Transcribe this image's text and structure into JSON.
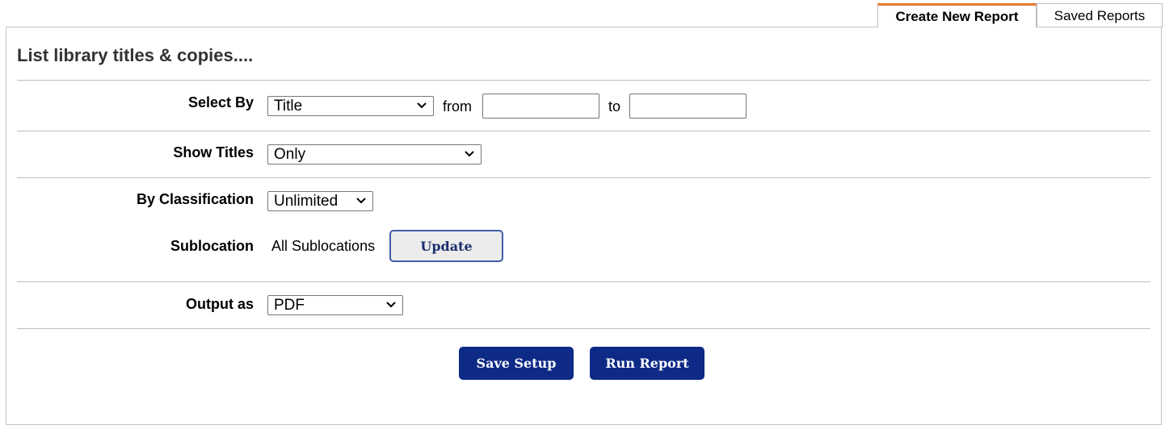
{
  "tabs": {
    "create_new_report": "Create New Report",
    "saved_reports": "Saved Reports",
    "active_accent": "#e8772e"
  },
  "report": {
    "title": "List library titles & copies...."
  },
  "select_by": {
    "label": "Select By",
    "value": "Title",
    "from_label": "from",
    "from_value": "",
    "to_label": "to",
    "to_value": ""
  },
  "show_titles": {
    "label": "Show Titles",
    "value": "Only"
  },
  "by_classification": {
    "label": "By Classification",
    "value": "Unlimited"
  },
  "sublocation": {
    "label": "Sublocation",
    "value": "All Sublocations",
    "update_button": "Update"
  },
  "output_as": {
    "label": "Output as",
    "value": "PDF"
  },
  "actions": {
    "save_setup": "Save Setup",
    "run_report": "Run Report",
    "button_color": "#0d2a86"
  },
  "icons": {
    "dropdown": "chevron-down-icon"
  }
}
